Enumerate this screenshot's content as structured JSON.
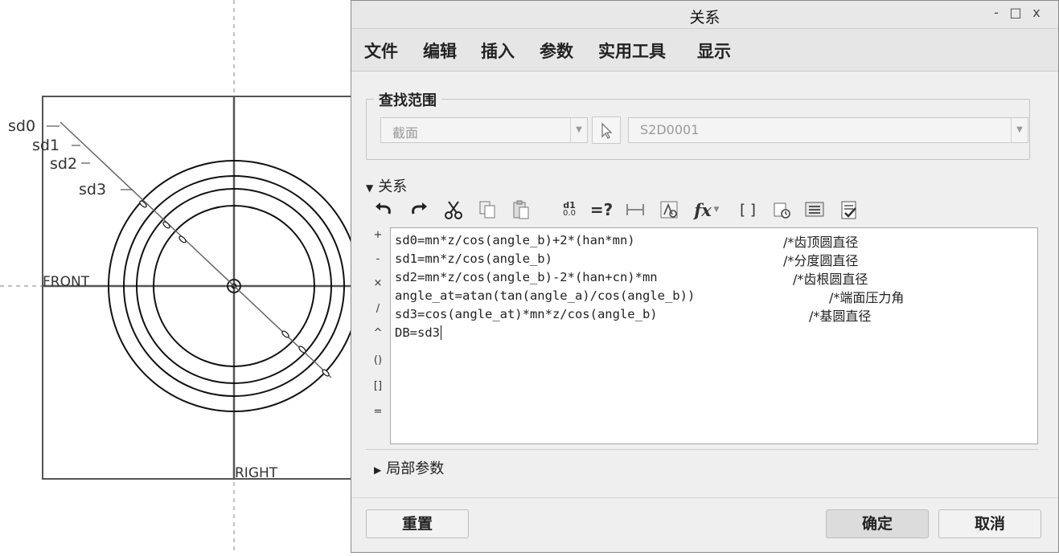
{
  "sketch": {
    "labels": {
      "sd0": "sd0",
      "sd1": "sd1",
      "sd2": "sd2",
      "sd3": "sd3",
      "front": "FRONT",
      "right": "RIGHT"
    }
  },
  "dialog": {
    "title": "关系",
    "window_controls": {
      "minimize": "-",
      "maximize": "□",
      "close": "x"
    },
    "menu": [
      "文件",
      "编辑",
      "插入",
      "参数",
      "实用工具",
      "显示"
    ],
    "search_scope": {
      "legend": "查找范围",
      "type_value": "截面",
      "object_value": "S2D0001"
    },
    "relations_section": {
      "header": "关系",
      "toolbar": [
        "undo-icon",
        "redo-icon",
        "cut-icon",
        "copy-icon",
        "paste-icon",
        "switch-dimensions-icon",
        "evaluate-icon",
        "dimension-icon",
        "parameter-table-icon",
        "function-icon",
        "parentheses-icon",
        "sort-icon",
        "show-icon",
        "verify-icon"
      ],
      "toolbar_text": {
        "switch_dims": "d1",
        "switch_dims_sub": "0.0",
        "evaluate": "=?",
        "function": "fx",
        "brackets": "[ ]"
      },
      "operators": [
        "+",
        "-",
        "×",
        "/",
        "^",
        "()",
        "[]",
        "="
      ],
      "lines": [
        {
          "code": "sd0=mn*z/cos(angle_b)+2*(han*mn)",
          "comment": "/*齿顶圆直径"
        },
        {
          "code": "sd1=mn*z/cos(angle_b)",
          "comment": "/*分度圆直径"
        },
        {
          "code": "sd2=mn*z/cos(angle_b)-2*(han+cn)*mn",
          "comment": "/*齿根圆直径"
        },
        {
          "code": "angle_at=atan(tan(angle_a)/cos(angle_b))",
          "comment": "/*端面压力角"
        },
        {
          "code": "sd3=cos(angle_at)*mn*z/cos(angle_b)",
          "comment": "/*基圆直径"
        },
        {
          "code": "DB=sd3",
          "comment": ""
        }
      ]
    },
    "local_params": {
      "header": "局部参数"
    },
    "buttons": {
      "reset": "重置",
      "ok": "确定",
      "cancel": "取消"
    }
  }
}
